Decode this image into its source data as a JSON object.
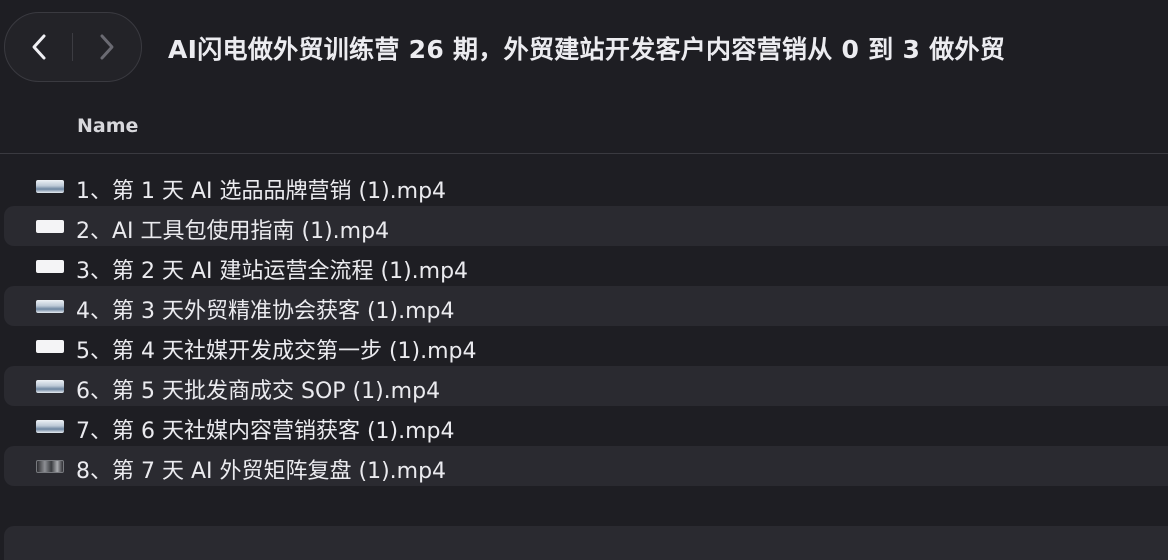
{
  "window": {
    "title": "AI闪电做外贸训练营 26 期，外贸建站开发客户内容营销从 0 到 3 做外贸"
  },
  "nav": {
    "back_icon": "chevron-left",
    "forward_icon": "chevron-right"
  },
  "columns": {
    "name": "Name"
  },
  "files": [
    {
      "name": "1、第 1 天 AI 选品品牌营销 (1).mp4",
      "thumbnail": "sky"
    },
    {
      "name": "2、AI 工具包使用指南 (1).mp4",
      "thumbnail": "white"
    },
    {
      "name": "3、第 2 天 AI 建站运营全流程 (1).mp4",
      "thumbnail": "white"
    },
    {
      "name": "4、第 3 天外贸精准协会获客 (1).mp4",
      "thumbnail": "sky"
    },
    {
      "name": "5、第 4 天社媒开发成交第一步 (1).mp4",
      "thumbnail": "white"
    },
    {
      "name": "6、第 5 天批发商成交 SOP (1).mp4",
      "thumbnail": "sky"
    },
    {
      "name": "7、第 6 天社媒内容营销获客 (1).mp4",
      "thumbnail": "sky"
    },
    {
      "name": "8、第 7 天 AI 外贸矩阵复盘 (1).mp4",
      "thumbnail": "dark"
    }
  ],
  "colors": {
    "background": "#1e1e23",
    "alt_row": "#2a2a30",
    "text": "#ebebef"
  }
}
